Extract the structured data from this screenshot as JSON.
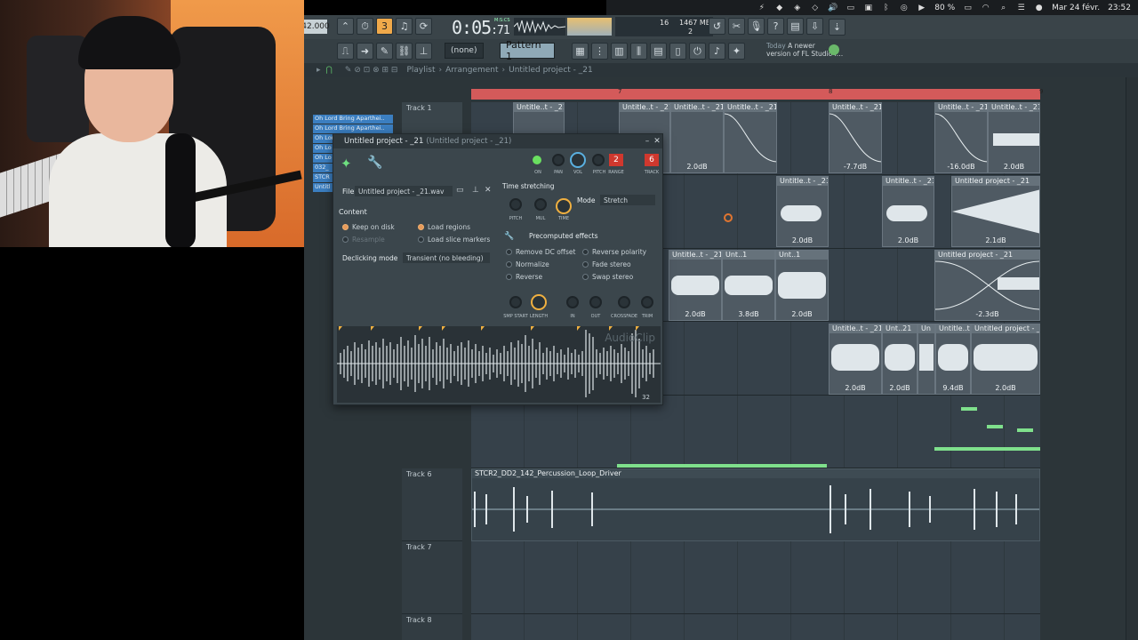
{
  "menubar": {
    "battery": "80 %",
    "date": "Mar 24 févr.",
    "clock": "23:52"
  },
  "toolbar": {
    "tempo": "42.000",
    "time": "0:05",
    "time_ms": ":71",
    "time_unit": "M:S:CS",
    "cpu_value": "16",
    "memory": "1467 MB",
    "voices": "2",
    "pattern_none": "(none)",
    "pattern": "Pattern 1",
    "hint_label": "Today",
    "hint_text": "A newer",
    "hint_text2": "version of FL Studio i…"
  },
  "breadcrumb": {
    "items": [
      "Playlist",
      "Arrangement",
      "Untitled project - _21"
    ]
  },
  "playlist": {
    "timeline_marks": [
      "7",
      "8",
      "9"
    ],
    "picker_channels": [
      "Oh Lord Bring Aparthei..",
      "Oh Lord Bring Aparthei..",
      "Oh Lord Bring Aparthei..",
      "Oh Lo",
      "Oh Lo",
      "032_",
      "STCR",
      "Untitl"
    ],
    "tracks": [
      "Track 1",
      "Track 6",
      "Track 7",
      "Track 8"
    ],
    "clip_short": "Untitle..t - _21",
    "clip_long": "Untitled project - _21",
    "clip_unt": "Unt..1",
    "clip_unt2": "Unt..21",
    "clip_un": "Un",
    "clip_until": "Untitle..t",
    "perc_clip": "STCR2_DD2_142_Percussion_Loop_Driver",
    "db_values": {
      "a": "2.0dB",
      "b": "-7.7dB",
      "c": "-16.0dB",
      "d": "2.1dB",
      "e": "3.8dB",
      "f": "-2.3dB",
      "g": "9.4dB"
    }
  },
  "channel": {
    "title": "Untitled project - _21",
    "title_sub": "(Untitled project - _21)",
    "knob_labels": [
      "ON",
      "PAN",
      "VOL",
      "PITCH",
      "RANGE",
      "TRACK"
    ],
    "pitch_range": "2",
    "track_num": "6",
    "file_label": "File",
    "file_name": "Untitled project - _21.wav",
    "content_label": "Content",
    "keep_on_disk": "Keep on disk",
    "load_regions": "Load regions",
    "resample": "Resample",
    "load_slice": "Load slice markers",
    "declick_label": "Declicking mode",
    "declick_value": "Transient (no bleeding)",
    "stretch_label": "Time stretching",
    "stretch_knobs": [
      "PITCH",
      "MUL",
      "TIME"
    ],
    "mode_label": "Mode",
    "mode_value": "Stretch",
    "precomp_label": "Precomputed effects",
    "fx": [
      "Remove DC offset",
      "Reverse polarity",
      "Normalize",
      "Fade stereo",
      "Reverse",
      "Swap stereo"
    ],
    "env_knobs": [
      "SMP START",
      "LENGTH",
      "IN",
      "OUT",
      "CROSSFADE",
      "TRIM"
    ],
    "watermark": "AudioClip",
    "zoom": "32"
  }
}
